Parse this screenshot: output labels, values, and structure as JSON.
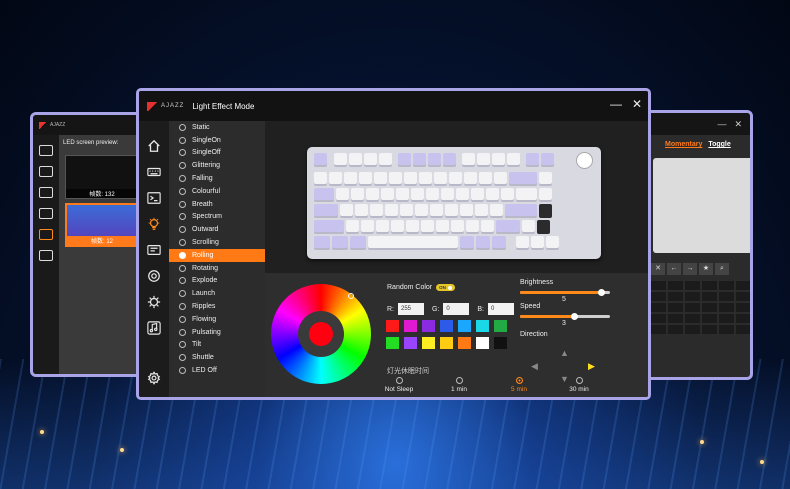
{
  "left_window": {
    "brand": "AJAZZ",
    "lcd_title": "LED screen preview:",
    "help": "?",
    "thumbs": [
      {
        "caption": "帧数: 132",
        "selected": false
      },
      {
        "caption": "帧数: 12",
        "selected": true
      }
    ]
  },
  "right_window": {
    "minimize": "—",
    "close": "✕",
    "modes": {
      "momentary": "Momentary",
      "toggle": "Toggle"
    },
    "toolbar": [
      "✕",
      "←",
      "→",
      "★",
      "⌕"
    ]
  },
  "main_window": {
    "brand": "AJAZZ",
    "title": "Light Effect Mode",
    "minimize": "—",
    "close": "✕",
    "rail_icons": [
      "home-icon",
      "keyboard-icon",
      "terminal-icon",
      "light-bulb-icon",
      "lcd-icon",
      "settings-gear-icon",
      "virus-icon",
      "music-icon",
      "settings-icon"
    ],
    "active_rail": 3,
    "effects": [
      "Static",
      "SingleOn",
      "SingleOff",
      "Glittering",
      "Falling",
      "Colourful",
      "Breath",
      "Spectrum",
      "Outward",
      "Scrolling",
      "Rolling",
      "Rotating",
      "Explode",
      "Launch",
      "Ripples",
      "Flowing",
      "Pulsating",
      "Tilt",
      "Shuttle",
      "LED Off"
    ],
    "active_effect": "Rolling",
    "color": {
      "random_label": "Random Color",
      "random_toggle": "ON",
      "r_label": "R:",
      "r_value": "255",
      "g_label": "G:",
      "g_value": "0",
      "b_label": "B:",
      "b_value": "0",
      "current": "#ff0010",
      "swatches": [
        "#ff1a1a",
        "#e01ad0",
        "#8a2be2",
        "#2b5be8",
        "#1aa7ff",
        "#1ad8e8",
        "#22aa44",
        "#22dd22",
        "#9a44ff",
        "#ffee22",
        "#ffcc11",
        "#ff7a14",
        "#ffffff",
        "#111111"
      ]
    },
    "sleep": {
      "label": "灯光休眠时间",
      "options": [
        "Not Sleep",
        "1 min",
        "5 min",
        "30 min"
      ],
      "selected": "5 min"
    },
    "brightness": {
      "label": "Brightness",
      "value": "5",
      "fraction": 0.9
    },
    "speed": {
      "label": "Speed",
      "value": "3",
      "fraction": 0.6
    },
    "direction": {
      "label": "Direction",
      "active": "right"
    }
  }
}
